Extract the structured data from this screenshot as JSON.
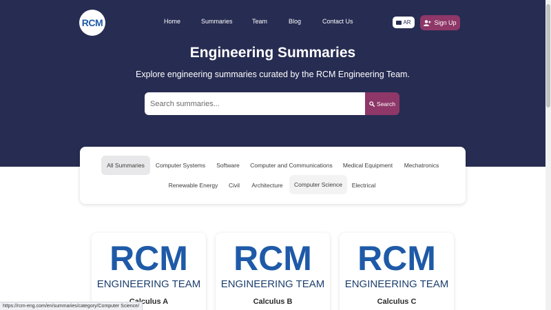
{
  "header": {
    "logo_text": "RCM",
    "nav": [
      {
        "label": "Home"
      },
      {
        "label": "Summaries"
      },
      {
        "label": "Team"
      },
      {
        "label": "Blog"
      },
      {
        "label": "Contact Us"
      }
    ],
    "language_label": "AR",
    "signup_label": "Sign Up"
  },
  "hero": {
    "title": "Engineering Summaries",
    "subtitle": "Explore engineering summaries curated by the RCM Engineering Team.",
    "search": {
      "placeholder": "Search summaries...",
      "value": "",
      "button_label": "Search"
    }
  },
  "filters": {
    "active": "All Summaries",
    "hovered": "Computer Science",
    "items": [
      {
        "label": "All Summaries"
      },
      {
        "label": "Computer Systems"
      },
      {
        "label": "Software"
      },
      {
        "label": "Computer and Communications"
      },
      {
        "label": "Medical Equipment"
      },
      {
        "label": "Mechatronics"
      },
      {
        "label": "Renewable Energy"
      },
      {
        "label": "Civil"
      },
      {
        "label": "Architecture"
      },
      {
        "label": "Computer Science"
      },
      {
        "label": "Electrical"
      }
    ]
  },
  "cards": [
    {
      "title": "Calculus A",
      "logo_top": "RCM",
      "logo_bottom": "ENGINEERING TEAM"
    },
    {
      "title": "Calculus B",
      "logo_top": "RCM",
      "logo_bottom": "ENGINEERING TEAM"
    },
    {
      "title": "Calculus C",
      "logo_top": "RCM",
      "logo_bottom": "ENGINEERING TEAM"
    }
  ],
  "status_bar": {
    "url": "https://rcm-eng.com/en/summaries/category/Computer Science/"
  },
  "colors": {
    "hero_bg": "#272c52",
    "accent": "#8e3768",
    "logo_blue": "#1e5aa8",
    "logo_dark": "#1c3f6e"
  },
  "icons": {
    "signup": "user-plus-icon",
    "search": "search-icon",
    "language": "flag-icon"
  }
}
